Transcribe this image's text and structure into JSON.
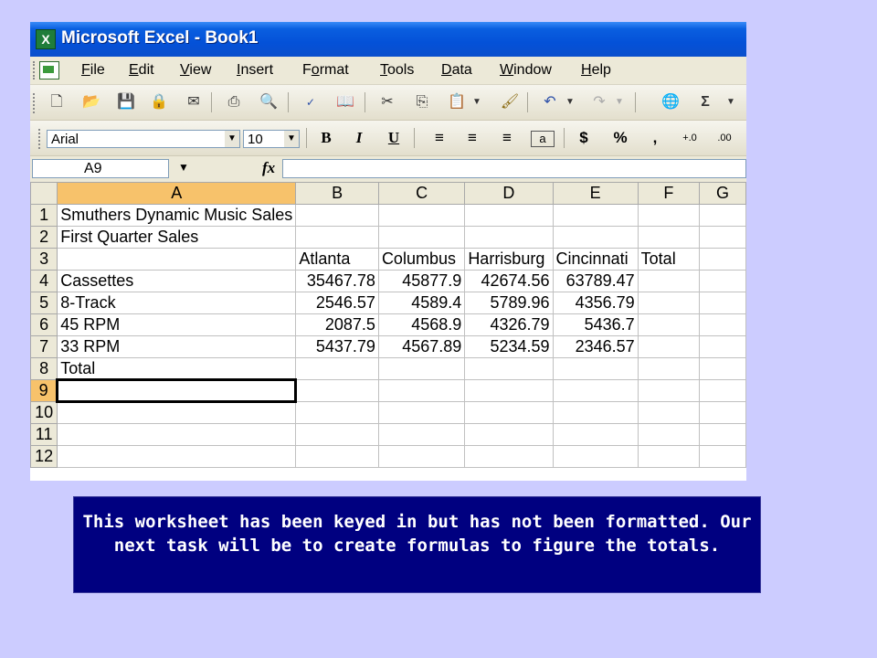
{
  "window": {
    "title": "Microsoft Excel - Book1",
    "app_icon": "excel-icon"
  },
  "menu": [
    {
      "first": "F",
      "rest": "ile"
    },
    {
      "first": "E",
      "rest": "dit"
    },
    {
      "first": "V",
      "rest": "iew"
    },
    {
      "first": "I",
      "rest": "nsert"
    },
    {
      "pre": "F",
      "first": "o",
      "rest": "rmat"
    },
    {
      "first": "T",
      "rest": "ools"
    },
    {
      "first": "D",
      "rest": "ata"
    },
    {
      "first": "W",
      "rest": "indow"
    },
    {
      "first": "H",
      "rest": "elp"
    }
  ],
  "format_toolbar": {
    "font": "Arial",
    "size": "10"
  },
  "formula_bar": {
    "name_box": "A9",
    "formula": ""
  },
  "grid": {
    "columns": [
      "A",
      "B",
      "C",
      "D",
      "E",
      "F",
      "G"
    ],
    "rows": [
      {
        "num": "1",
        "cells": [
          "Smuthers Dynamic Music Sales",
          "",
          "",
          "",
          "",
          "",
          ""
        ]
      },
      {
        "num": "2",
        "cells": [
          "First Quarter Sales",
          "",
          "",
          "",
          "",
          "",
          ""
        ]
      },
      {
        "num": "3",
        "cells": [
          "",
          "Atlanta",
          "Columbus",
          "Harrisburg",
          "Cincinnati",
          "Total",
          ""
        ]
      },
      {
        "num": "4",
        "cells": [
          "Cassettes",
          "35467.78",
          "45877.9",
          "42674.56",
          "63789.47",
          "",
          ""
        ]
      },
      {
        "num": "5",
        "cells": [
          "8-Track",
          "2546.57",
          "4589.4",
          "5789.96",
          "4356.79",
          "",
          ""
        ]
      },
      {
        "num": "6",
        "cells": [
          "45 RPM",
          "2087.5",
          "4568.9",
          "4326.79",
          "5436.7",
          "",
          ""
        ]
      },
      {
        "num": "7",
        "cells": [
          "33 RPM",
          "5437.79",
          "4567.89",
          "5234.59",
          "2346.57",
          "",
          ""
        ]
      },
      {
        "num": "8",
        "cells": [
          "Total",
          "",
          "",
          "",
          "",
          "",
          ""
        ]
      },
      {
        "num": "9",
        "cells": [
          "",
          "",
          "",
          "",
          "",
          "",
          ""
        ]
      },
      {
        "num": "10",
        "cells": [
          "",
          "",
          "",
          "",
          "",
          "",
          ""
        ]
      },
      {
        "num": "11",
        "cells": [
          "",
          "",
          "",
          "",
          "",
          "",
          ""
        ]
      },
      {
        "num": "12",
        "cells": [
          "",
          "",
          "",
          "",
          "",
          "",
          ""
        ]
      }
    ],
    "selected_cell": "A9"
  },
  "caption": "This worksheet has been keyed in but has not been formatted.  Our next task will be to create formulas to figure the totals.",
  "colors": {
    "background": "#ccccff",
    "caption_bg": "#000080",
    "titlebar": "#0451d8",
    "active_header": "#f7c26b"
  }
}
